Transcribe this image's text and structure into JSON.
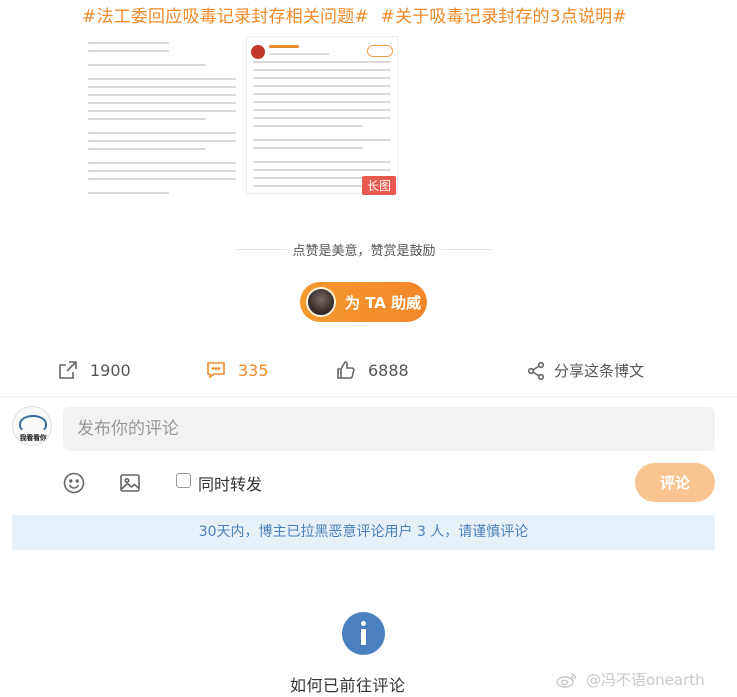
{
  "topics": [
    "#法工委回应吸毒记录封存相关问题#",
    "#关于吸毒记录封存的3点说明#"
  ],
  "thumbnail": {
    "long_image_badge": "长图"
  },
  "praise_line": "点赞是美意，赞赏是鼓励",
  "support_button": "为 TA 助威",
  "actions": {
    "share_count": "1900",
    "comment_count": "335",
    "like_count": "6888",
    "forward_label": "分享这条博文"
  },
  "composer": {
    "avatar_text": "我看看你",
    "placeholder": "发布你的评论",
    "repost_label": "同时转发",
    "submit_label": "评论"
  },
  "notice": "30天内，博主已拉黑恶意评论用户 3 人，请谨慎评论",
  "bottom_text": "如何已前往评论",
  "watermark": "@冯不语onearth",
  "colors": {
    "accent": "#f08a28",
    "info_blue": "#4a80c0",
    "notice_bg": "#e6f0f9"
  }
}
